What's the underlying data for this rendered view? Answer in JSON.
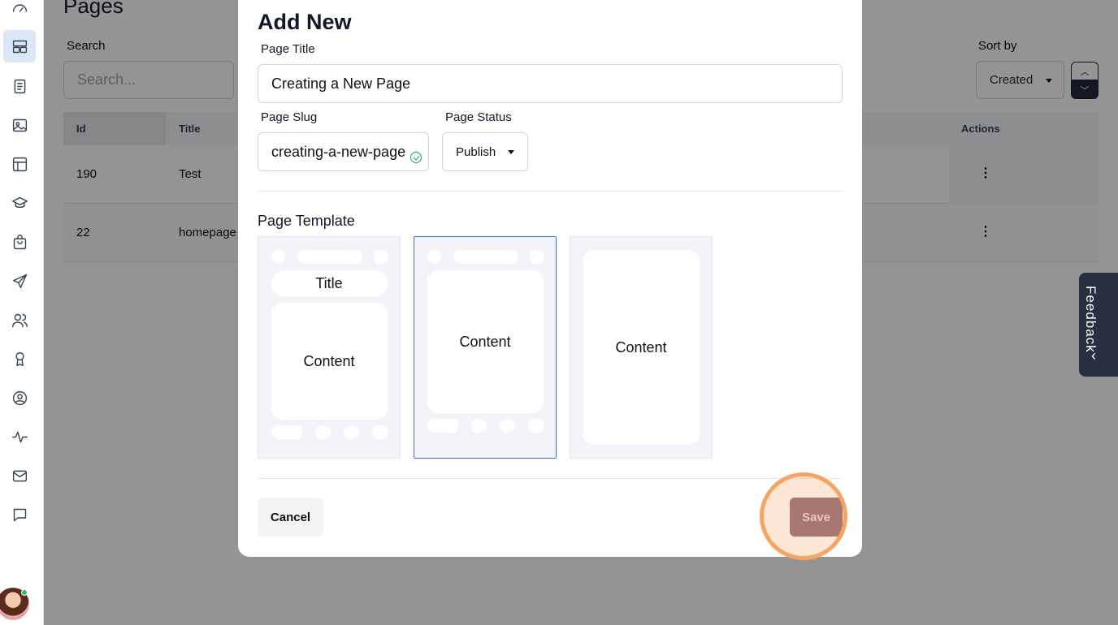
{
  "page": {
    "title": "Pages",
    "search_label": "Search",
    "search_placeholder": "Search...",
    "sort_label": "Sort by",
    "sort_value": "Created"
  },
  "table": {
    "headers": {
      "id": "Id",
      "title": "Title",
      "actions": "Actions"
    },
    "rows": [
      {
        "id": "190",
        "title": "Test"
      },
      {
        "id": "22",
        "title": "homepage"
      }
    ]
  },
  "feedback": {
    "label": "Feedback"
  },
  "modal": {
    "title": "Add New",
    "page_title_label": "Page Title",
    "page_title_value": "Creating a New Page",
    "page_slug_label": "Page Slug",
    "page_slug_value": "creating-a-new-page",
    "page_status_label": "Page Status",
    "page_status_value": "Publish",
    "page_template_label": "Page Template",
    "templates": [
      {
        "title": "Title",
        "content": "Content"
      },
      {
        "content": "Content"
      },
      {
        "content": "Content"
      }
    ],
    "cancel_label": "Cancel",
    "save_label": "Save"
  },
  "colors": {
    "accent_highlight": "#f6a463",
    "save_button": "#8b6677",
    "selected_template_border": "#3b6fc7"
  }
}
